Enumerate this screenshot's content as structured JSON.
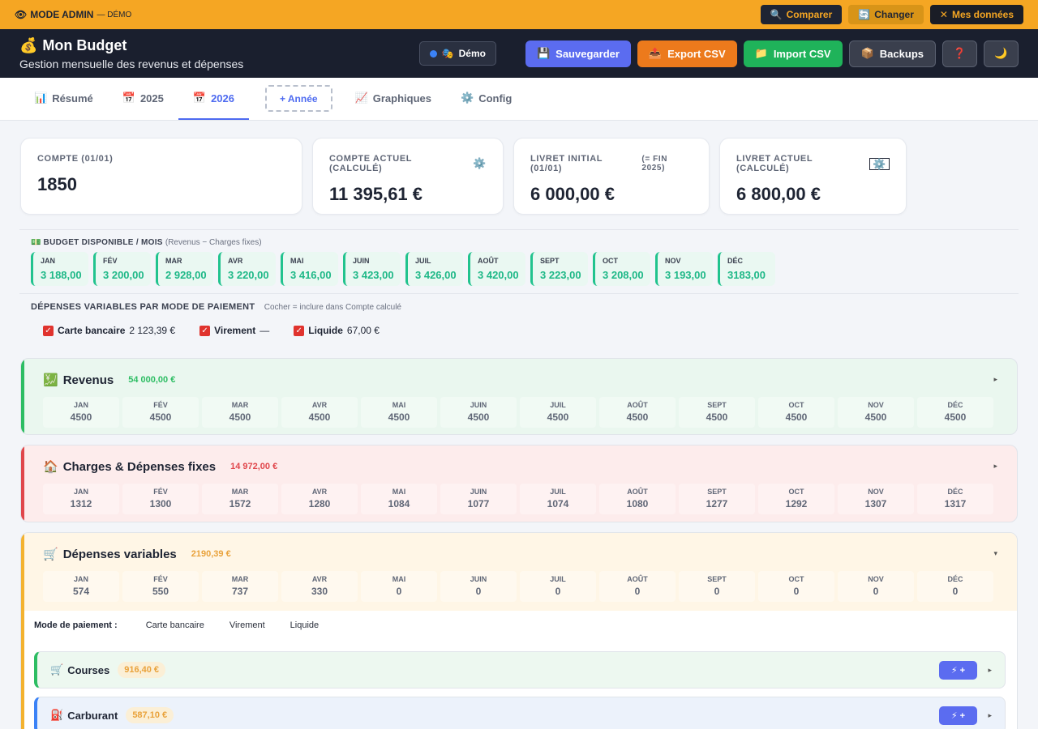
{
  "admin": {
    "icon": "eye-icon",
    "label": "MODE ADMIN",
    "suffix": "— DÉMO",
    "buttons": [
      {
        "icon": "🔍",
        "label": "Comparer"
      },
      {
        "icon": "🔄",
        "label": "Changer"
      },
      {
        "icon": "✕",
        "label": "Mes données"
      }
    ]
  },
  "header": {
    "icon": "💰",
    "title": "Mon Budget",
    "subtitle": "Gestion mensuelle des revenus et dépenses",
    "demo_label": "Démo",
    "demo_icon": "🎭",
    "buttons": {
      "save": {
        "icon": "💾",
        "label": "Sauvegarder"
      },
      "export": {
        "icon": "📤",
        "label": "Export CSV"
      },
      "import": {
        "icon": "📁",
        "label": "Import CSV"
      },
      "backups": {
        "icon": "📦",
        "label": "Backups"
      },
      "help": "❓",
      "theme": "🌙"
    }
  },
  "tabs": [
    {
      "icon": "📊",
      "label": "Résumé"
    },
    {
      "icon": "📅",
      "label": "2025"
    },
    {
      "icon": "📅",
      "label": "2026"
    },
    {
      "icon": "📈",
      "label": "Graphiques"
    },
    {
      "icon": "⚙️",
      "label": "Config"
    }
  ],
  "add_year": "+ Année",
  "cards": [
    {
      "label": "COMPTE (01/01)",
      "value": "1850"
    },
    {
      "label": "COMPTE ACTUEL (CALCULÉ)",
      "value": "11 395,61 €",
      "gear": "⚙️"
    },
    {
      "label": "LIVRET INITIAL (01/01)",
      "note": "(= FIN 2025)",
      "value": "6 000,00 €"
    },
    {
      "label": "LIVRET ACTUEL (CALCULÉ)",
      "value": "6 800,00 €",
      "gear": "⚙️"
    }
  ],
  "budget": {
    "icon": "💵",
    "title": "BUDGET DISPONIBLE / MOIS",
    "note": "(Revenus − Charges fixes)",
    "months": [
      {
        "m": "JAN",
        "v": "3 188,00"
      },
      {
        "m": "FÉV",
        "v": "3 200,00"
      },
      {
        "m": "MAR",
        "v": "2 928,00"
      },
      {
        "m": "AVR",
        "v": "3 220,00"
      },
      {
        "m": "MAI",
        "v": "3 416,00"
      },
      {
        "m": "JUIN",
        "v": "3 423,00"
      },
      {
        "m": "JUIL",
        "v": "3 426,00"
      },
      {
        "m": "AOÛT",
        "v": "3 420,00"
      },
      {
        "m": "SEPT",
        "v": "3 223,00"
      },
      {
        "m": "OCT",
        "v": "3 208,00"
      },
      {
        "m": "NOV",
        "v": "3 193,00"
      },
      {
        "m": "DÉC",
        "v": "3183,00"
      }
    ]
  },
  "payment": {
    "title": "DÉPENSES VARIABLES PAR MODE DE PAIEMENT",
    "hint": "Cocher = inclure dans Compte calculé",
    "items": [
      {
        "name": "Carte bancaire",
        "value": "2 123,39 €"
      },
      {
        "name": "Virement",
        "value": "—"
      },
      {
        "name": "Liquide",
        "value": "67,00 €"
      }
    ]
  },
  "revenus": {
    "icon": "💹",
    "title": "Revenus",
    "total": "54 000,00 €",
    "caret": "▸",
    "months": [
      {
        "m": "JAN",
        "v": "4500"
      },
      {
        "m": "FÉV",
        "v": "4500"
      },
      {
        "m": "MAR",
        "v": "4500"
      },
      {
        "m": "AVR",
        "v": "4500"
      },
      {
        "m": "MAI",
        "v": "4500"
      },
      {
        "m": "JUIN",
        "v": "4500"
      },
      {
        "m": "JUIL",
        "v": "4500"
      },
      {
        "m": "AOÛT",
        "v": "4500"
      },
      {
        "m": "SEPT",
        "v": "4500"
      },
      {
        "m": "OCT",
        "v": "4500"
      },
      {
        "m": "NOV",
        "v": "4500"
      },
      {
        "m": "DÉC",
        "v": "4500"
      }
    ]
  },
  "charges": {
    "icon": "🏠",
    "title": "Charges & Dépenses fixes",
    "total": "14 972,00 €",
    "caret": "▸",
    "months": [
      {
        "m": "JAN",
        "v": "1312"
      },
      {
        "m": "FÉV",
        "v": "1300"
      },
      {
        "m": "MAR",
        "v": "1572"
      },
      {
        "m": "AVR",
        "v": "1280"
      },
      {
        "m": "MAI",
        "v": "1084"
      },
      {
        "m": "JUIN",
        "v": "1077"
      },
      {
        "m": "JUIL",
        "v": "1074"
      },
      {
        "m": "AOÛT",
        "v": "1080"
      },
      {
        "m": "SEPT",
        "v": "1277"
      },
      {
        "m": "OCT",
        "v": "1292"
      },
      {
        "m": "NOV",
        "v": "1307"
      },
      {
        "m": "DÉC",
        "v": "1317"
      }
    ]
  },
  "variables": {
    "icon": "🛒",
    "title": "Dépenses variables",
    "total": "2190,39 €",
    "caret": "▾",
    "months": [
      {
        "m": "JAN",
        "v": "574"
      },
      {
        "m": "FÉV",
        "v": "550"
      },
      {
        "m": "MAR",
        "v": "737"
      },
      {
        "m": "AVR",
        "v": "330"
      },
      {
        "m": "MAI",
        "v": "0"
      },
      {
        "m": "JUIN",
        "v": "0"
      },
      {
        "m": "JUIL",
        "v": "0"
      },
      {
        "m": "AOÛT",
        "v": "0"
      },
      {
        "m": "SEPT",
        "v": "0"
      },
      {
        "m": "OCT",
        "v": "0"
      },
      {
        "m": "NOV",
        "v": "0"
      },
      {
        "m": "DÉC",
        "v": "0"
      }
    ],
    "paymode_label": "Mode de paiement :",
    "paymodes": [
      "Carte bancaire",
      "Virement",
      "Liquide"
    ],
    "subs": [
      {
        "icon": "🛒",
        "name": "Courses",
        "amount": "916,40 €",
        "action": "+"
      },
      {
        "icon": "⛽",
        "name": "Carburant",
        "amount": "587,10 €",
        "action": "+"
      }
    ]
  }
}
